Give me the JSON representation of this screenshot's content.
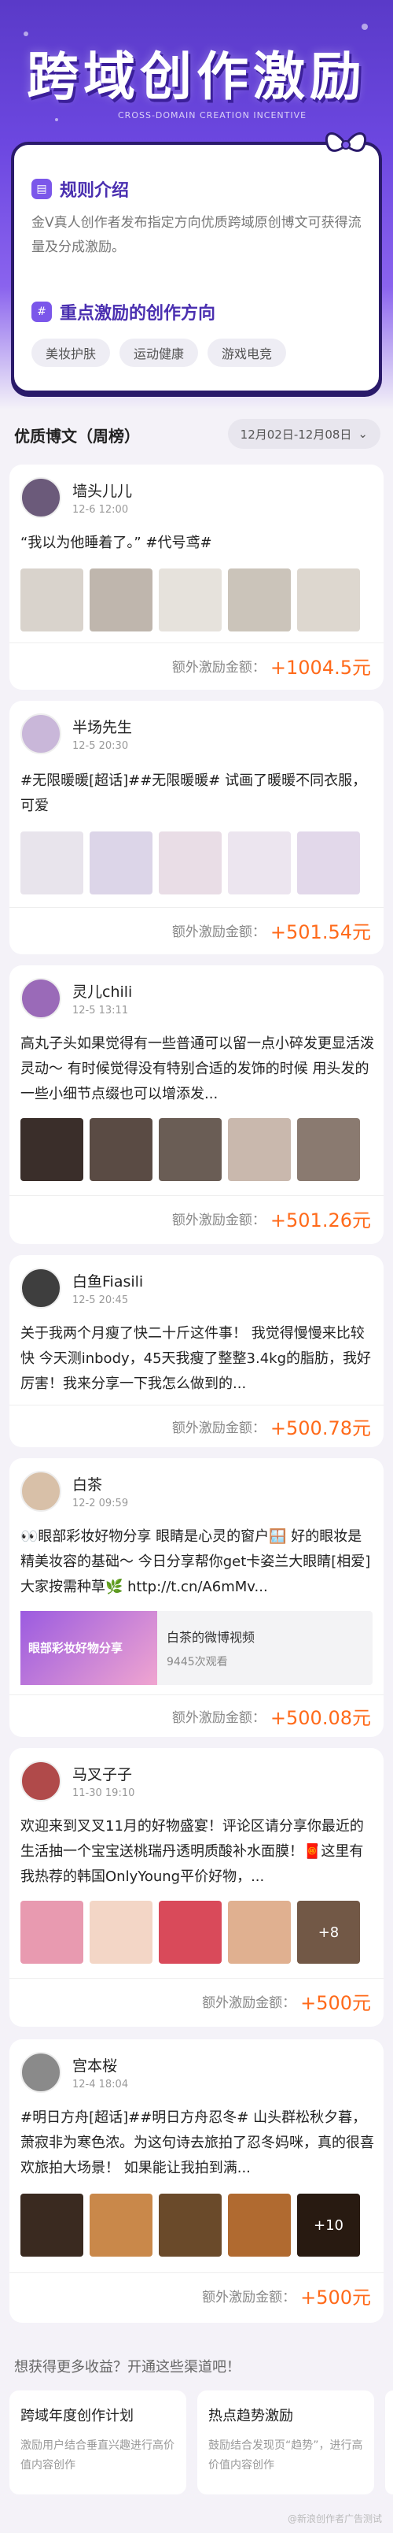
{
  "header": {
    "title": "跨域创作激励",
    "subtitle": "CROSS-DOMAIN CREATION INCENTIVE"
  },
  "rules": {
    "title": "规则介绍",
    "text": "金V真人创作者发布指定方向优质跨域原创博文可获得流量及分成激励。",
    "focus_title": "重点激励的创作方向",
    "tags": [
      "美妆护肤",
      "运动健康",
      "游戏电竞"
    ]
  },
  "list": {
    "title": "优质博文（周榜）",
    "date_range": "12月02日-12月08日"
  },
  "reward_label": "额外激励金额：",
  "posts": [
    {
      "name": "墙头儿儿",
      "time": "12-6 12:00",
      "text": "“我以为他睡着了。” #代号鸢#",
      "amount": "+1004.5元",
      "thumbs": [
        "#d9d3cc",
        "#bfb6ad",
        "#e6e2dc",
        "#cbc4ba",
        "#ddd7cf"
      ],
      "avatar_color": "#6b5a7a"
    },
    {
      "name": "半场先生",
      "time": "12-5 20:30",
      "text": "#无限暖暖[超话]##无限暖暖# 试画了暖暖不同衣服，可爱",
      "amount": "+501.54元",
      "thumbs": [
        "#e8e4ec",
        "#dcd5e8",
        "#e9dde6",
        "#ece5ef",
        "#e2d8ea"
      ],
      "avatar_color": "#c9b7d9"
    },
    {
      "name": "灵儿chili",
      "time": "12-5 13:11",
      "text": "高丸子头如果觉得有一些普通可以留一点小碎发更显活泼灵动～ 有时候觉得没有特别合适的发饰的时候 用头发的一些小细节点缀也可以增添发...",
      "amount": "+501.26元",
      "thumbs": [
        "#3a2e2a",
        "#5a4b44",
        "#6a5d55",
        "#c9b8ad",
        "#8a7a70"
      ],
      "avatar_color": "#9a6ab8"
    },
    {
      "name": "白鱼Fiasili",
      "time": "12-5 20:45",
      "text": "关于我两个月瘦了快二十斤这件事！ 我觉得慢慢来比较快 今天测inbody，45天我瘦了整整3.4kg的脂肪，我好厉害！我来分享一下我怎么做到的...",
      "amount": "+500.78元",
      "thumbs": [],
      "avatar_color": "#3e3e3e"
    },
    {
      "name": "白茶",
      "time": "12-2 09:59",
      "text": "👀眼部彩妆好物分享 眼睛是心灵的窗户🪟 好的眼妆是精美妆容的基础～ 今日分享帮你get卡姿兰大眼睛[相爱] 大家按需种草🌿 http://t.cn/A6mMv...",
      "amount": "+500.08元",
      "share": {
        "title": "白茶的微博视频",
        "views": "9445次观看",
        "img_text": "眼部彩妆好物分享"
      },
      "thumbs": [],
      "avatar_color": "#d8c0a8"
    },
    {
      "name": "马叉子子",
      "time": "11-30 19:10",
      "text": "欢迎来到叉叉11月的好物盛宴！评论区请分享你最近的生活抽一个宝宝送桃瑞丹透明质酸补水面膜！🧧这里有我热荐的韩国OnlyYoung平价好物，...",
      "amount": "+500元",
      "thumbs": [
        "#e89ab0",
        "#f3d6c6",
        "#d94a5a",
        "#e0b090",
        "#d0a080"
      ],
      "more": "+8",
      "avatar_color": "#b04a4a"
    },
    {
      "name": "宫本桜",
      "time": "12-4 18:04",
      "text": "#明日方舟[超话]##明日方舟忍冬# 山头群松秋夕暮，萧寂非为寒色浓。为这句诗去旅拍了忍冬妈咪，真的很喜欢旅拍大场景！ 如果能让我拍到满...",
      "amount": "+500元",
      "thumbs": [
        "#3a2a20",
        "#c9884a",
        "#6a4a2a",
        "#b06a30",
        "#4a3020"
      ],
      "more": "+10",
      "avatar_color": "#8a8a8a"
    }
  ],
  "more": {
    "title": "想获得更多收益？开通这些渠道吧！",
    "channels": [
      {
        "title": "跨域年度创作计划",
        "desc": "激励用户结合垂直兴趣进行高价值内容创作"
      },
      {
        "title": "热点趋势激励",
        "desc": "鼓励结合发现页“趋势”，进行高价值内容创作"
      }
    ]
  },
  "watermark": "@新浪创作者广告测试"
}
